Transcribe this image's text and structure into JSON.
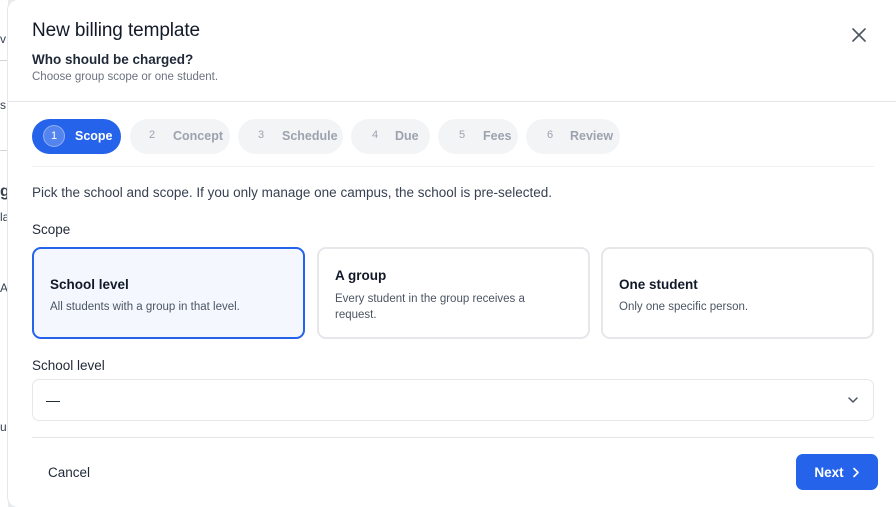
{
  "background_fragments": [
    "v",
    "s",
    "g",
    "la",
    "A",
    "u"
  ],
  "dialog": {
    "title": "New billing template",
    "subtitle": "Who should be charged?",
    "description": "Choose group scope or one student.",
    "close_icon": "close-icon"
  },
  "stepper": {
    "steps": [
      {
        "number": "1",
        "label": "Scope",
        "active": true
      },
      {
        "number": "2",
        "label": "Concept",
        "active": false
      },
      {
        "number": "3",
        "label": "Schedule",
        "active": false
      },
      {
        "number": "4",
        "label": "Due",
        "active": false
      },
      {
        "number": "5",
        "label": "Fees",
        "active": false
      },
      {
        "number": "6",
        "label": "Review",
        "active": false
      }
    ]
  },
  "body": {
    "intro": "Pick the school and scope. If you only manage one campus, the school is pre-selected.",
    "scope_label": "Scope",
    "scope_options": [
      {
        "title": "School level",
        "description": "All students with a group in that level.",
        "selected": true
      },
      {
        "title": "A group",
        "description": "Every student in the group receives a request.",
        "selected": false
      },
      {
        "title": "One student",
        "description": "Only one specific person.",
        "selected": false
      }
    ],
    "school_level_label": "School level",
    "school_level_value": "—"
  },
  "footer": {
    "cancel_label": "Cancel",
    "next_label": "Next"
  },
  "colors": {
    "accent": "#2563eb",
    "selected_card_bg": "#f4f7fe"
  }
}
